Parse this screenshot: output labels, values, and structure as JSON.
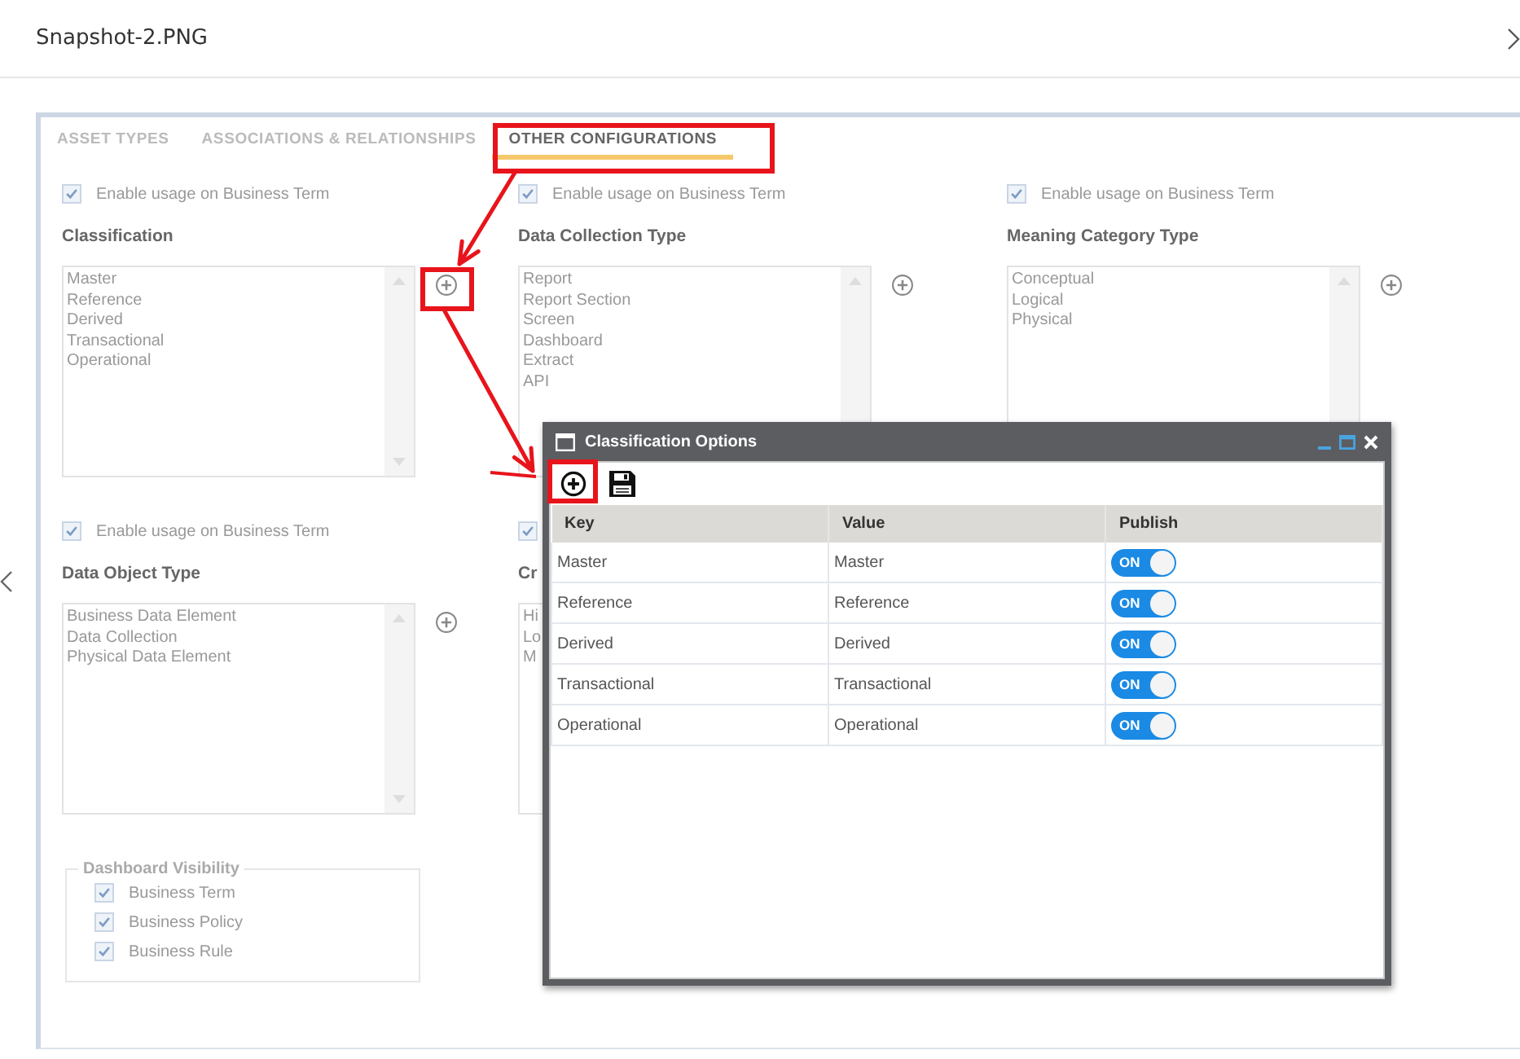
{
  "viewer": {
    "title": "Snapshot-2.PNG"
  },
  "tabs": [
    {
      "label": "ASSET TYPES",
      "selected": false
    },
    {
      "label": "ASSOCIATIONS & RELATIONSHIPS",
      "selected": false
    },
    {
      "label": "OTHER CONFIGURATIONS",
      "selected": true
    }
  ],
  "sections": [
    {
      "enable_label": "Enable usage on Business Term",
      "checked": true,
      "heading": "Classification",
      "items": [
        "Master",
        "Reference",
        "Derived",
        "Transactional",
        "Operational"
      ]
    },
    {
      "enable_label": "Enable usage on Business Term",
      "checked": true,
      "heading": "Data Collection Type",
      "items": [
        "Report",
        "Report Section",
        "Screen",
        "Dashboard",
        "Extract",
        "API"
      ]
    },
    {
      "enable_label": "Enable usage on Business Term",
      "checked": true,
      "heading": "Meaning Category Type",
      "items": [
        "Conceptual",
        "Logical",
        "Physical"
      ]
    },
    {
      "enable_label": "Enable usage on Business Term",
      "checked": true,
      "heading": "Data Object Type",
      "items": [
        "Business Data Element",
        "Data Collection",
        "Physical Data Element"
      ]
    },
    {
      "checked": true,
      "heading": "Cr",
      "items": [
        "Hi",
        "Lo",
        "M"
      ]
    }
  ],
  "dashboard_visibility": {
    "legend": "Dashboard Visibility",
    "items": [
      {
        "label": "Business Term",
        "checked": true
      },
      {
        "label": "Business Policy",
        "checked": true
      },
      {
        "label": "Business Rule",
        "checked": true
      }
    ]
  },
  "dialog": {
    "title": "Classification Options",
    "columns": [
      "Key",
      "Value",
      "Publish"
    ],
    "rows": [
      {
        "key": "Master",
        "value": "Master",
        "publish": "ON",
        "on": true
      },
      {
        "key": "Reference",
        "value": "Reference",
        "publish": "ON",
        "on": true
      },
      {
        "key": "Derived",
        "value": "Derived",
        "publish": "ON",
        "on": true
      },
      {
        "key": "Transactional",
        "value": "Transactional",
        "publish": "ON",
        "on": true
      },
      {
        "key": "Operational",
        "value": "Operational",
        "publish": "ON",
        "on": true
      }
    ]
  }
}
